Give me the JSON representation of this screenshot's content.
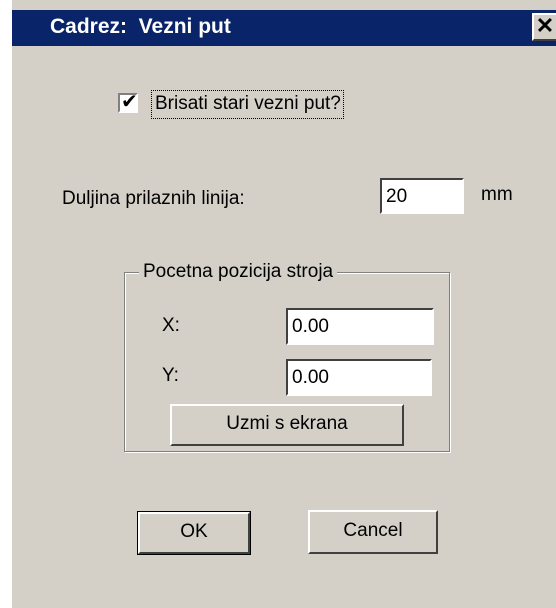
{
  "dialog": {
    "title": "Cadrez:  Vezni put",
    "close_label": "✕"
  },
  "checkbox": {
    "label": "Brisati stari vezni put?",
    "checked": true,
    "mark": "✔"
  },
  "length": {
    "label": "Duljina prilaznih linija:",
    "value": "20",
    "unit": "mm"
  },
  "group": {
    "legend": "Pocetna pozicija stroja",
    "x_label": "X:",
    "x_value": "0.00",
    "y_label": "Y:",
    "y_value": "0.00",
    "take_button": "Uzmi s ekrana"
  },
  "buttons": {
    "ok": "OK",
    "cancel": "Cancel"
  },
  "colors": {
    "titlebar": "#0a246a",
    "face": "#d4d0c8"
  }
}
